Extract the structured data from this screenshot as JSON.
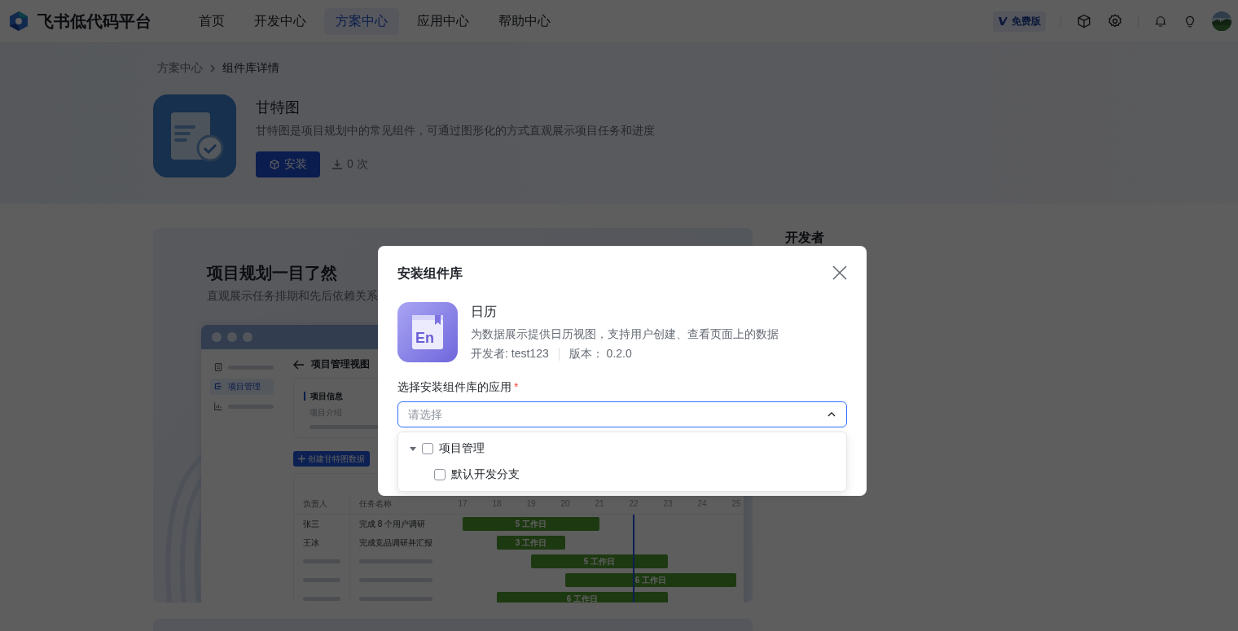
{
  "header": {
    "brand": "飞书低代码平台",
    "plan_badge": "免费版",
    "nav": [
      {
        "label": "首页",
        "selected": false
      },
      {
        "label": "开发中心",
        "selected": false
      },
      {
        "label": "方案中心",
        "selected": true
      },
      {
        "label": "应用中心",
        "selected": false
      },
      {
        "label": "帮助中心",
        "selected": false
      }
    ]
  },
  "breadcrumb": [
    "方案中心",
    "组件库详情"
  ],
  "component": {
    "title": "甘特图",
    "description": "甘特图是项目规划中的常见组件，可通过图形化的方式直观展示项目任务和进度",
    "install_button": "安装",
    "downloads": "0 次"
  },
  "preview": {
    "headline": "项目规划一目了然",
    "subline": "直观展示任务排期和先后依赖关系",
    "mock": {
      "sidebar": [
        {
          "kind": "placeholder",
          "selected": false
        },
        {
          "kind": "text",
          "label": "项目管理",
          "selected": true
        },
        {
          "kind": "placeholder",
          "selected": false
        }
      ],
      "view_title": "项目管理视图",
      "info_heading": "项目信息",
      "info_label": "项目介绍",
      "create_button": "创建甘特图数据",
      "columns": [
        "负责人",
        "任务名称"
      ],
      "days": [
        "17",
        "18",
        "19",
        "20",
        "21",
        "22",
        "23",
        "24",
        "25"
      ],
      "rows": [
        {
          "owner": "张三",
          "task": "完成 8 个用户调研",
          "bar": "5 工作日"
        },
        {
          "owner": "王冰",
          "task": "完成竞品调研并汇报",
          "bar": "3 工作日"
        },
        {
          "bar": "5 工作日"
        },
        {
          "bar": "6 工作日"
        },
        {
          "bar": "6 工作日"
        }
      ]
    }
  },
  "side_heading": "开发者",
  "modal": {
    "title": "安装组件库",
    "app": {
      "icon_label": "En",
      "name": "日历",
      "description": "为数据展示提供日历视图，支持用户创建、查看页面上的数据",
      "developer": "开发者: test123",
      "version": "版本：  0.2.0"
    },
    "field_label": "选择安装组件库的应用",
    "required_mark": "*",
    "select": {
      "placeholder": "请选择",
      "open": true
    },
    "options": [
      {
        "label": "项目管理",
        "checked": false,
        "expanded": true,
        "children": [
          {
            "label": "默认开发分支",
            "checked": false
          }
        ]
      }
    ]
  }
}
